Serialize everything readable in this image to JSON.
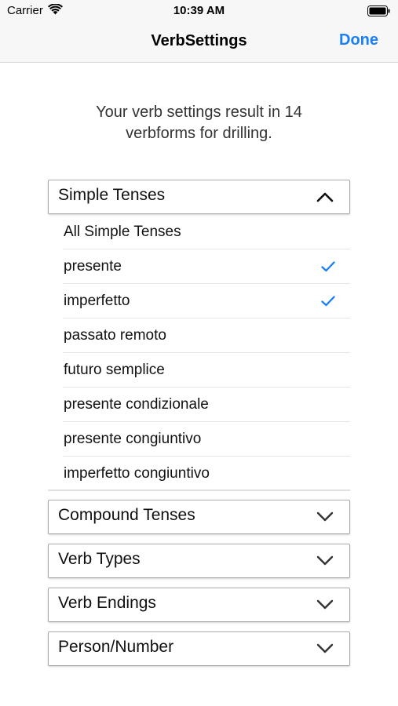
{
  "status_bar": {
    "carrier": "Carrier",
    "time": "10:39 AM"
  },
  "nav": {
    "title": "VerbSettings",
    "done_label": "Done"
  },
  "summary": {
    "line1": "Your verb settings result in 14",
    "line2": "verbforms for drilling."
  },
  "sections": {
    "simple": {
      "label": "Simple Tenses",
      "expanded": true
    },
    "compound": {
      "label": "Compound Tenses",
      "expanded": false
    },
    "verb_types": {
      "label": "Verb Types",
      "expanded": false
    },
    "verb_endings": {
      "label": "Verb Endings",
      "expanded": false
    },
    "person_number": {
      "label": "Person/Number",
      "expanded": false
    }
  },
  "simple_items": [
    {
      "label": "All Simple Tenses",
      "checked": false
    },
    {
      "label": "presente",
      "checked": true
    },
    {
      "label": "imperfetto",
      "checked": true
    },
    {
      "label": "passato remoto",
      "checked": false
    },
    {
      "label": "futuro semplice",
      "checked": false
    },
    {
      "label": "presente condizionale",
      "checked": false
    },
    {
      "label": "presente congiuntivo",
      "checked": false
    },
    {
      "label": "imperfetto congiuntivo",
      "checked": false
    }
  ],
  "colors": {
    "accent": "#1a7ff5",
    "bar_background": "#f7f7f7"
  }
}
